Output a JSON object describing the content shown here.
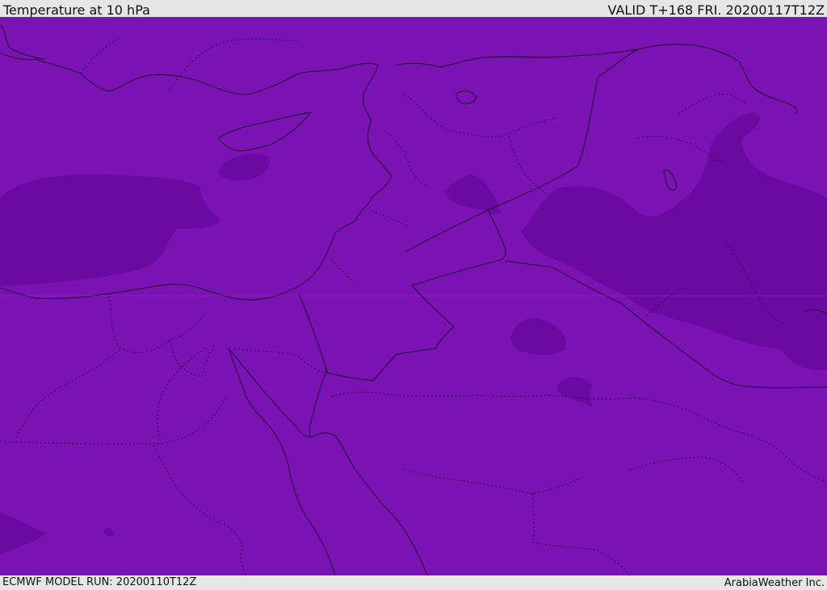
{
  "header": {
    "title": "Temperature at 10 hPa",
    "valid": "VALID T+168 FRI. 20200117T12Z"
  },
  "footer": {
    "model_run": "ECMWF MODEL RUN: 20200110T12Z",
    "credit": "ArabiaWeather Inc."
  },
  "colors": {
    "field_base": "#7b12b4",
    "field_cold": "#6a0aa0",
    "boundary": "#1a0a2a"
  }
}
